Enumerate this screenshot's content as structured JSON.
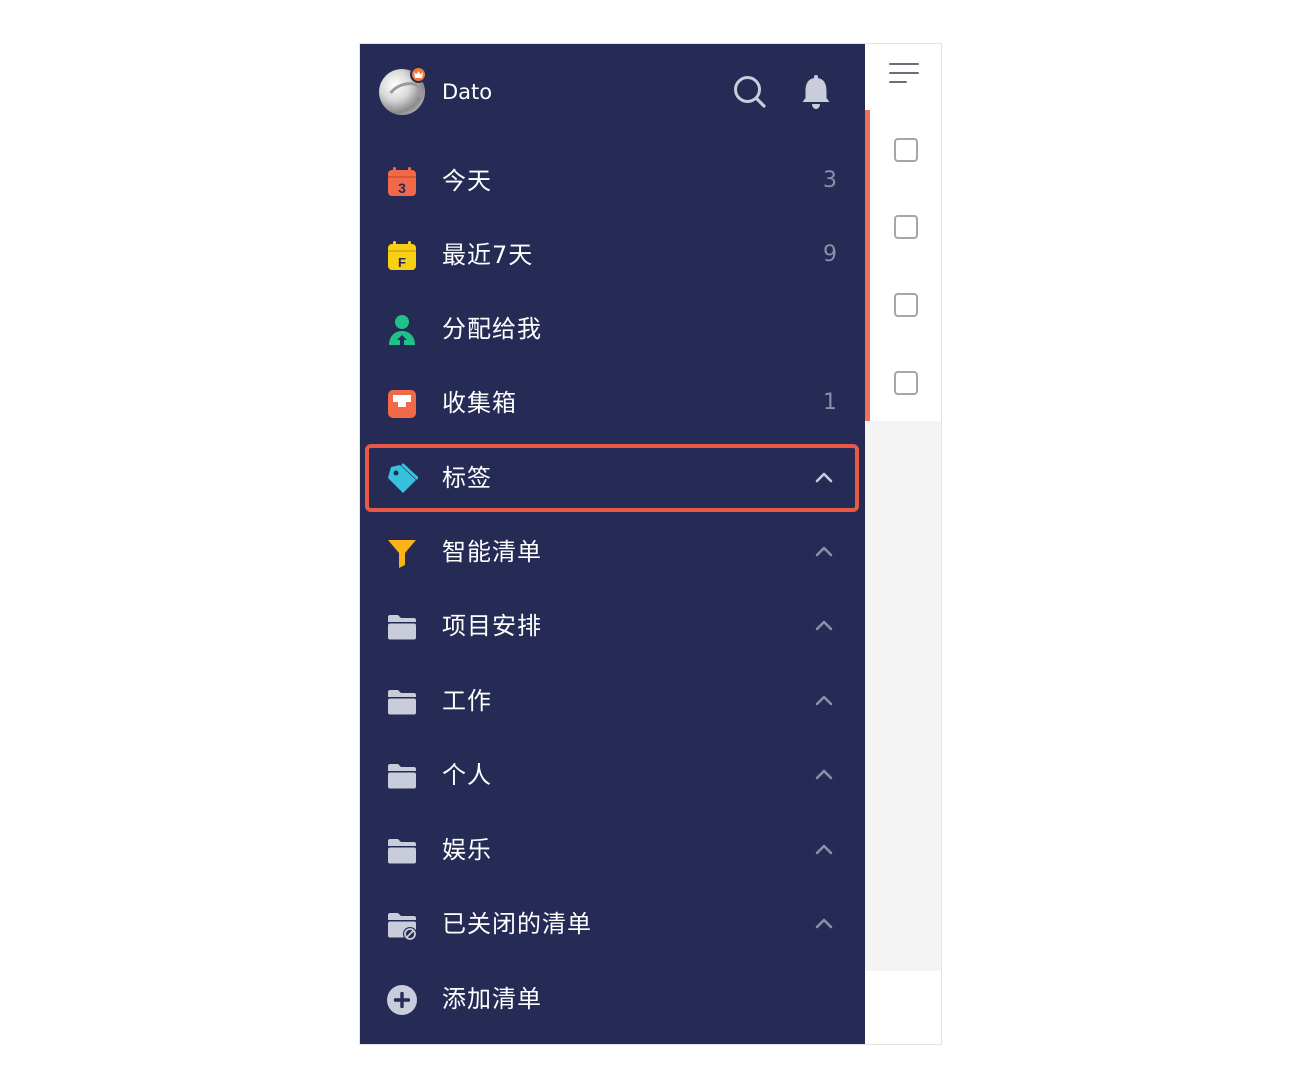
{
  "header": {
    "username": "Dato",
    "icons": [
      "avatar",
      "crown-badge-icon",
      "search-icon",
      "bell-icon"
    ]
  },
  "menu": [
    {
      "label": "今天",
      "count": "3",
      "icon": "calendar-today-icon",
      "icon_text": "3",
      "color": "#f06a4a"
    },
    {
      "label": "最近7天",
      "count": "9",
      "icon": "calendar-week-icon",
      "icon_text": "F",
      "color": "#f8cf12"
    },
    {
      "label": "分配给我",
      "count": "",
      "icon": "assigned-person-icon",
      "color": "#1fc08a"
    },
    {
      "label": "收集箱",
      "count": "1",
      "icon": "inbox-icon",
      "color": "#f06a4a"
    },
    {
      "label": "标签",
      "count": "",
      "icon": "tag-icon",
      "color": "#36c1dd",
      "expandable": true,
      "highlighted": true
    },
    {
      "label": "智能清单",
      "count": "",
      "icon": "filter-icon",
      "color": "#fbb315",
      "expandable": true
    },
    {
      "label": "项目安排",
      "count": "",
      "icon": "folder-icon",
      "color": "#c9ccda",
      "expandable": true
    },
    {
      "label": "工作",
      "count": "",
      "icon": "folder-icon",
      "color": "#c9ccda",
      "expandable": true
    },
    {
      "label": "个人",
      "count": "",
      "icon": "folder-icon",
      "color": "#c9ccda",
      "expandable": true
    },
    {
      "label": "娱乐",
      "count": "",
      "icon": "folder-icon",
      "color": "#c9ccda",
      "expandable": true
    },
    {
      "label": "已关闭的清单",
      "count": "",
      "icon": "closed-folder-icon",
      "color": "#c9ccda",
      "expandable": true
    },
    {
      "label": "添加清单",
      "count": "",
      "icon": "add-circle-icon",
      "color": "#c9ccda"
    }
  ],
  "colors": {
    "drawer_bg": "#252b55",
    "highlight_border": "#e85a45",
    "count_text": "#8a8fa9"
  }
}
